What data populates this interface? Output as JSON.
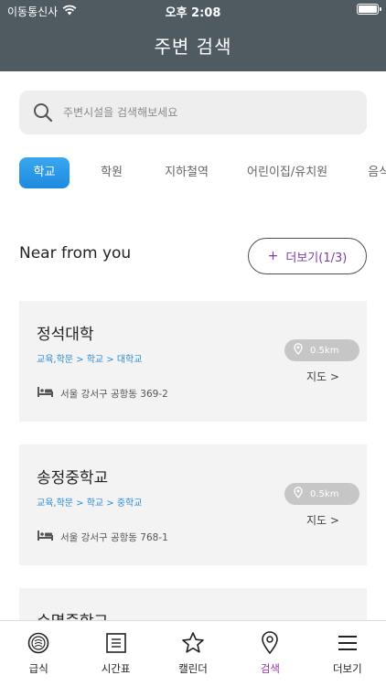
{
  "status_bar": {
    "carrier": "이동통신사",
    "time": "오후 2:08"
  },
  "header": {
    "title": "주변 검색"
  },
  "search": {
    "placeholder": "주변시설을 검색해보세요"
  },
  "categories": [
    {
      "label": "학교",
      "active": true
    },
    {
      "label": "학원",
      "active": false
    },
    {
      "label": "지하철역",
      "active": false
    },
    {
      "label": "어린이집/유치원",
      "active": false
    },
    {
      "label": "음식",
      "active": false
    }
  ],
  "near": {
    "title": "Near from you",
    "more_plus": "+",
    "more_label": "더보기(1/3)"
  },
  "places": [
    {
      "name": "정석대학",
      "category": "교육,학문 > 학교 > 대학교",
      "distance": "0.5km",
      "map_label": "지도 >",
      "address": "서울 강서구 공항동 369-2"
    },
    {
      "name": "송정중학교",
      "category": "교육,학문 > 학교 > 중학교",
      "distance": "0.5km",
      "map_label": "지도 >",
      "address": "서울 강서구 공항동 768-1"
    },
    {
      "name": "수명중학교"
    }
  ],
  "tabbar": {
    "items": [
      {
        "label": "급식",
        "icon": "meal-plate-icon"
      },
      {
        "label": "시간표",
        "icon": "timetable-icon"
      },
      {
        "label": "캘린더",
        "icon": "star-icon"
      },
      {
        "label": "검색",
        "icon": "location-pin-icon"
      },
      {
        "label": "더보기",
        "icon": "menu-icon"
      }
    ],
    "active_index": 3
  },
  "colors": {
    "header_bg": "#4f5b61",
    "accent_blue": "#2a8ad4",
    "tab_active_bg": "#1d8ae0",
    "active_purple": "#9a2fb0"
  }
}
